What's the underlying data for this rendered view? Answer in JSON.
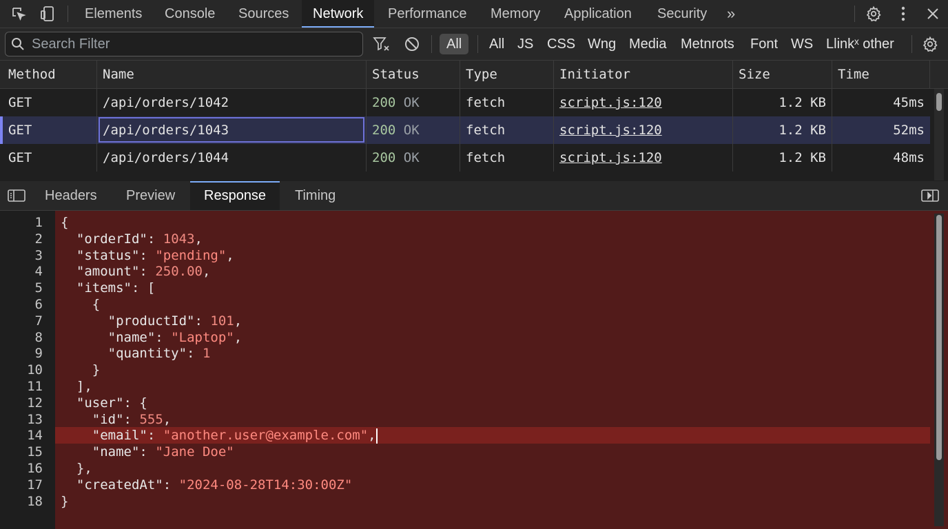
{
  "topbar": {
    "tabs": [
      "Elements",
      "Console",
      "Sources",
      "Network",
      "Performance",
      "Memory",
      "Application",
      "Security"
    ],
    "active_tab": "Network",
    "more_label": "»"
  },
  "filterbar": {
    "search_placeholder": "Search Filter",
    "active_chip": "All",
    "types": [
      "All",
      "JS",
      "CSS",
      "Wng",
      "Media",
      "Metnrots",
      "Font",
      "WS",
      "Llinkˣ other"
    ]
  },
  "table": {
    "columns": [
      "Method",
      "Name",
      "Status",
      "Type",
      "Initiator",
      "Size",
      "Time"
    ],
    "rows": [
      {
        "method": "GET",
        "name": "/api/orders/1042",
        "status_code": "200",
        "status_text": "OK",
        "type": "fetch",
        "initiator": "script.js:120",
        "size": "1.2 KB",
        "time": "45ms"
      },
      {
        "method": "GET",
        "name": "/api/orders/1043",
        "status_code": "200",
        "status_text": "OK",
        "type": "fetch",
        "initiator": "script.js:120",
        "size": "1.2 KB",
        "time": "52ms"
      },
      {
        "method": "GET",
        "name": "/api/orders/1044",
        "status_code": "200",
        "status_text": "OK",
        "type": "fetch",
        "initiator": "script.js:120",
        "size": "1.2 KB",
        "time": "48ms"
      }
    ],
    "selected_row": 1
  },
  "detail": {
    "tabs": [
      "Headers",
      "Preview",
      "Response",
      "Timing"
    ],
    "active_tab": "Response"
  },
  "response": {
    "lines": [
      "{",
      "  \"orderId\": 1043,",
      "  \"status\": \"pending\",",
      "  \"amount\": 250.00,",
      "  \"items\": [",
      "    {",
      "      \"productId\": 101,",
      "      \"name\": \"Laptop\",",
      "      \"quantity\": 1",
      "    }",
      "  ],",
      "  \"user\": {",
      "    \"id\": 555,",
      "    \"email\": \"another.user@example.com\",",
      "    \"name\": \"Jane Doe\"",
      "  },",
      "  \"createdAt\": \"2024-08-28T14:30:00Z\"",
      "}"
    ],
    "highlighted_line": 14
  },
  "colors": {
    "accent": "#7cacf8",
    "panel_bg": "#521b1a",
    "highlight_bg": "#7a211e",
    "selected_row_bg": "#2c2f4a"
  }
}
